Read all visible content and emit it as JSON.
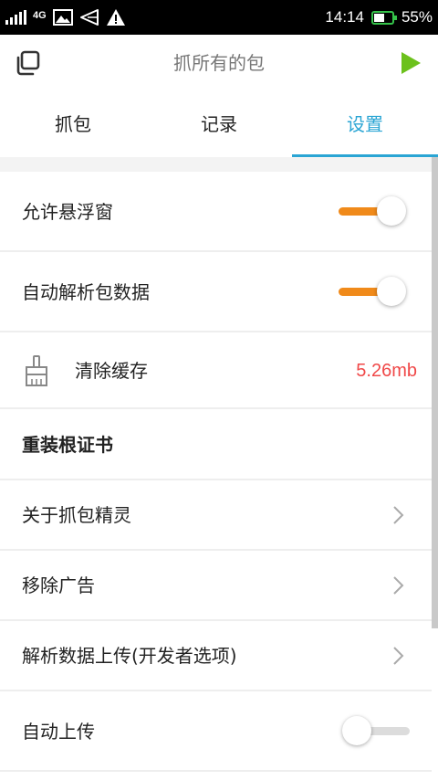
{
  "status_bar": {
    "network": "4G",
    "time": "14:14",
    "battery": "55%",
    "icons": [
      "signal-icon",
      "network-4g-icon",
      "image-icon",
      "send-icon",
      "warning-icon",
      "battery-icon"
    ]
  },
  "header": {
    "title": "抓所有的包",
    "left_icon": "copy-windows-icon",
    "right_icon": "play-icon"
  },
  "tabs": [
    {
      "label": "抓包",
      "active": false
    },
    {
      "label": "记录",
      "active": false
    },
    {
      "label": "设置",
      "active": true
    }
  ],
  "settings": {
    "float_window": {
      "label": "允许悬浮窗",
      "enabled": true
    },
    "auto_parse": {
      "label": "自动解析包数据",
      "enabled": true
    },
    "clear_cache": {
      "label": "清除缓存",
      "value": "5.26mb",
      "icon": "brush-icon"
    },
    "reinstall_cert": {
      "label": "重装根证书"
    },
    "about": {
      "label": "关于抓包精灵"
    },
    "remove_ads": {
      "label": "移除广告"
    },
    "upload_parsed": {
      "label": "解析数据上传(开发者选项)"
    },
    "auto_upload": {
      "label": "自动上传",
      "enabled": false
    }
  },
  "colors": {
    "accent": "#2aa5d4",
    "toggle_on": "#f08a1a",
    "cache_value": "#f04848",
    "play": "#6cc11c"
  }
}
